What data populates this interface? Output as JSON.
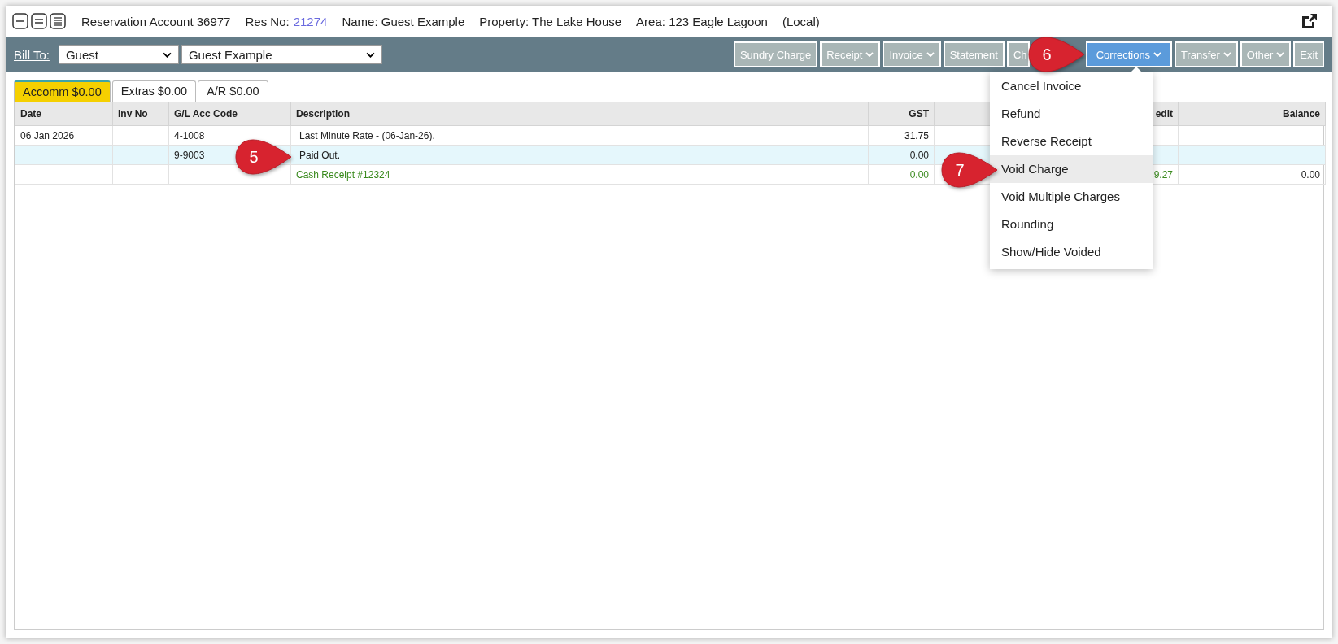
{
  "header": {
    "account": "Reservation Account 36977",
    "res_no_label": "Res No:",
    "res_no": "21274",
    "name": "Name: Guest Example",
    "property": "Property: The Lake House",
    "area": "Area: 123 Eagle Lagoon",
    "scope": "(Local)"
  },
  "toolbar": {
    "bill_to_label": "Bill To:",
    "bill_to_type": "Guest",
    "bill_to_name": "Guest Example",
    "buttons": [
      {
        "label": "Sundry Charge",
        "dropdown": false,
        "selected": false
      },
      {
        "label": "Receipt",
        "dropdown": true,
        "selected": false
      },
      {
        "label": "Invoice",
        "dropdown": true,
        "selected": false
      },
      {
        "label": "Statement",
        "dropdown": false,
        "selected": false
      },
      {
        "label": "Ch",
        "dropdown": false,
        "selected": false
      },
      {
        "label": "Corrections",
        "dropdown": true,
        "selected": true
      },
      {
        "label": "Transfer",
        "dropdown": true,
        "selected": false
      },
      {
        "label": "Other",
        "dropdown": true,
        "selected": false
      },
      {
        "label": "Exit",
        "dropdown": false,
        "selected": false
      }
    ]
  },
  "tabs": [
    {
      "label": "Accomm $0.00",
      "selected": true
    },
    {
      "label": "Extras $0.00",
      "selected": false
    },
    {
      "label": "A/R $0.00",
      "selected": false
    }
  ],
  "table": {
    "columns": [
      {
        "label": "Date"
      },
      {
        "label": "Inv No"
      },
      {
        "label": "G/L Acc Code"
      },
      {
        "label": "Description"
      },
      {
        "label": "GST"
      },
      {},
      {
        "label": "edit"
      },
      {
        "label": "Balance"
      }
    ],
    "rows": [
      {
        "kind": "charge",
        "selected": false,
        "cells": [
          "06 Jan 2026",
          null,
          "4-1008",
          "Last Minute Rate  - (06-Jan-26).",
          "31.75",
          null,
          null,
          null
        ]
      },
      {
        "kind": "charge",
        "selected": true,
        "cells": [
          null,
          null,
          "9-9003",
          "Paid Out.",
          "0.00",
          null,
          null,
          null
        ]
      },
      {
        "kind": "receipt",
        "selected": false,
        "cells": [
          null,
          null,
          null,
          "Cash Receipt #12324",
          "0.00",
          null,
          "9.27",
          "0.00"
        ]
      }
    ]
  },
  "menu": {
    "items": [
      {
        "label": "Cancel Invoice",
        "selected": false
      },
      {
        "label": "Refund",
        "selected": false
      },
      {
        "label": "Reverse Receipt",
        "selected": false
      },
      {
        "label": "Void Charge",
        "selected": true
      },
      {
        "label": "Void Multiple Charges",
        "selected": false
      },
      {
        "label": "Rounding",
        "selected": false
      },
      {
        "label": "Show/Hide Voided",
        "selected": false
      }
    ]
  },
  "callouts": [
    {
      "label": "5"
    },
    {
      "label": "6"
    },
    {
      "label": "7"
    }
  ]
}
